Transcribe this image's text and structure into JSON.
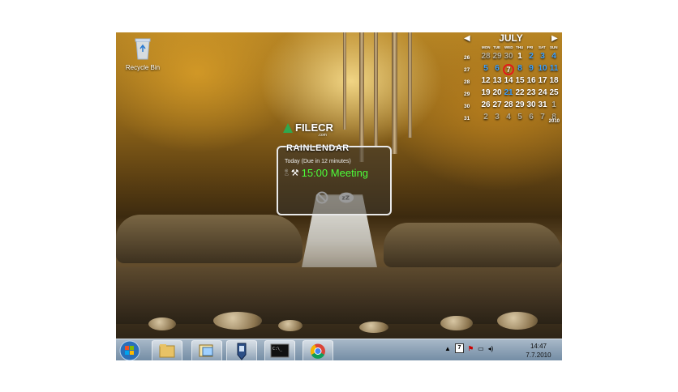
{
  "desktop": {
    "recycle_bin_label": "Recycle Bin",
    "watermark": {
      "brand": "FILECR",
      "sub": ".com"
    }
  },
  "calendar": {
    "month": "JULY",
    "year": "2010",
    "dows": [
      "MON",
      "TUE",
      "WED",
      "THU",
      "FRI",
      "SAT",
      "SUN"
    ],
    "weeks": [
      "26",
      "27",
      "28",
      "29",
      "30",
      "31"
    ],
    "days": [
      [
        "28",
        "29",
        "30",
        "1",
        "2",
        "3",
        "4"
      ],
      [
        "5",
        "6",
        "7",
        "8",
        "9",
        "10",
        "11"
      ],
      [
        "12",
        "13",
        "14",
        "15",
        "16",
        "17",
        "18"
      ],
      [
        "19",
        "20",
        "21",
        "22",
        "23",
        "24",
        "25"
      ],
      [
        "26",
        "27",
        "28",
        "29",
        "30",
        "31",
        "1"
      ],
      [
        "2",
        "3",
        "4",
        "5",
        "6",
        "7",
        "8"
      ]
    ],
    "today": "7"
  },
  "popup": {
    "title": "RAINLENDAR",
    "subtitle": "Today (Due in 12 minutes)",
    "event_time": "15:00",
    "event_name": "Meeting"
  },
  "taskbar": {
    "tray_date_icon": "7",
    "clock_time": "14:47",
    "clock_date": "7.7.2010"
  },
  "colors": {
    "event_green": "#4cff3a",
    "today_ring": "#e21b1b",
    "event_blue": "#3aa0ff"
  }
}
